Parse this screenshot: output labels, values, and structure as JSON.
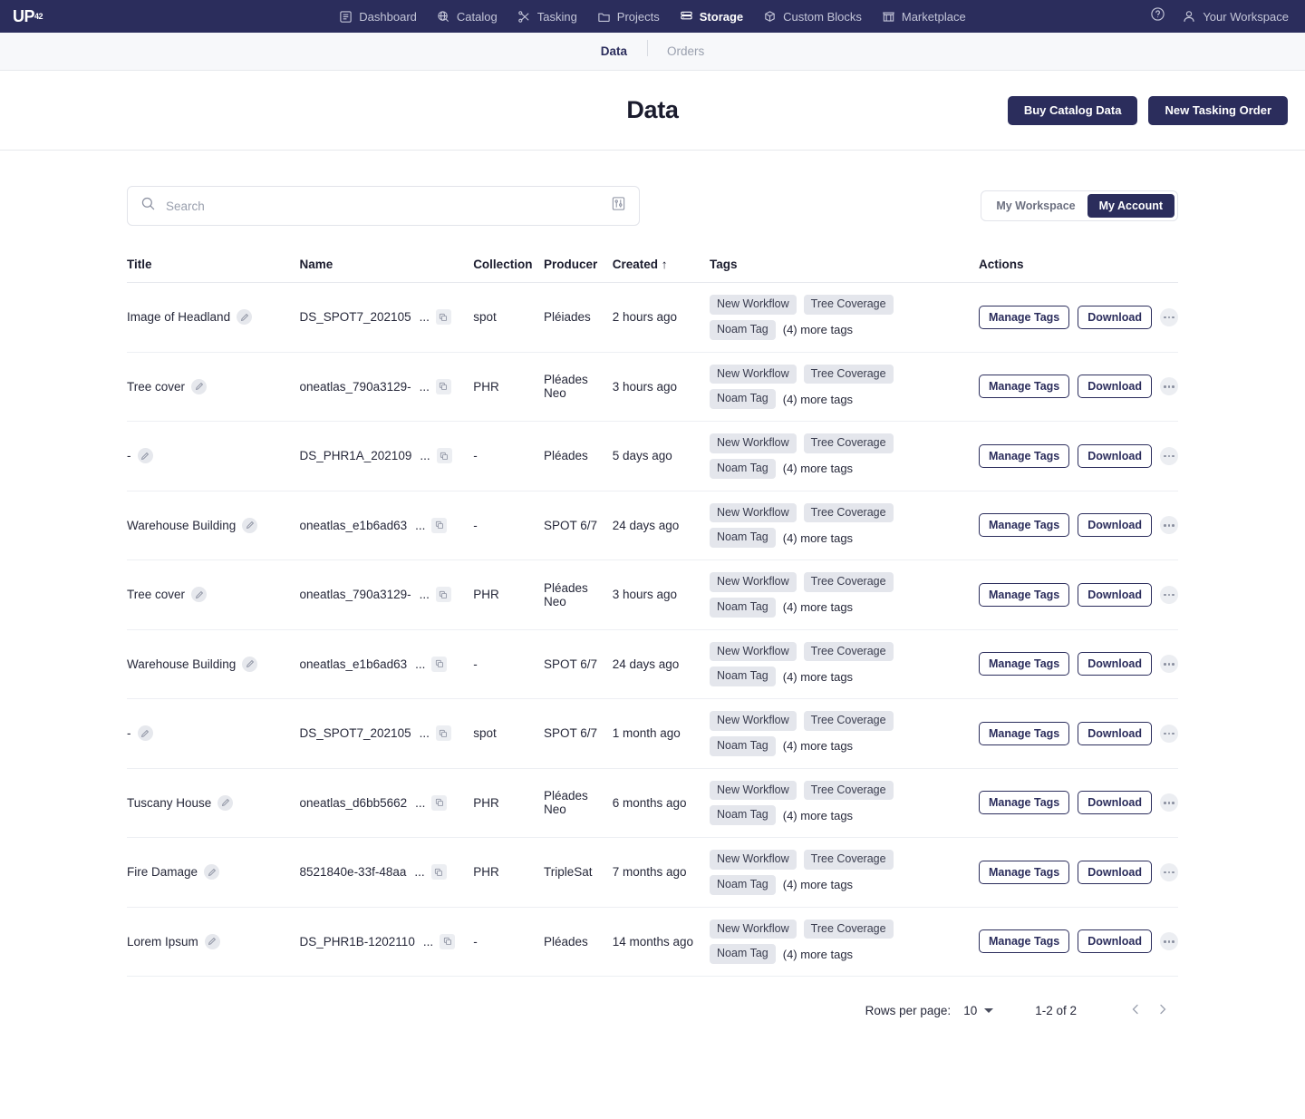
{
  "brand": {
    "name": "UP",
    "sup": "42",
    "accent": "#2b2d5c"
  },
  "topnav": {
    "items": [
      {
        "label": "Dashboard",
        "icon": "dashboard-icon",
        "active": false
      },
      {
        "label": "Catalog",
        "icon": "catalog-globe-icon",
        "active": false
      },
      {
        "label": "Tasking",
        "icon": "tasking-satellite-icon",
        "active": false
      },
      {
        "label": "Projects",
        "icon": "folder-icon",
        "active": false
      },
      {
        "label": "Storage",
        "icon": "storage-stack-icon",
        "active": true
      },
      {
        "label": "Custom Blocks",
        "icon": "cube-icon",
        "active": false
      },
      {
        "label": "Marketplace",
        "icon": "marketplace-store-icon",
        "active": false
      }
    ],
    "help_icon": "help-circle-icon",
    "account_icon": "user-icon",
    "account_label": "Your Workspace"
  },
  "subtabs": [
    {
      "label": "Data",
      "active": true
    },
    {
      "label": "Orders",
      "active": false
    }
  ],
  "header": {
    "title": "Data",
    "buy_catalog_label": "Buy Catalog Data",
    "new_tasking_label": "New Tasking Order"
  },
  "search": {
    "placeholder": "Search",
    "value": "",
    "icon": "search-icon",
    "filter_icon": "filter-sliders-icon"
  },
  "scope_toggle": {
    "options": [
      {
        "label": "My Workspace",
        "active": false
      },
      {
        "label": "My Account",
        "active": true
      }
    ]
  },
  "table": {
    "columns": [
      {
        "key": "title",
        "label": "Title"
      },
      {
        "key": "name",
        "label": "Name"
      },
      {
        "key": "collection",
        "label": "Collection"
      },
      {
        "key": "producer",
        "label": "Producer"
      },
      {
        "key": "created",
        "label": "Created ↑"
      },
      {
        "key": "tags",
        "label": "Tags"
      },
      {
        "key": "actions",
        "label": "Actions"
      }
    ],
    "row_actions": {
      "manage_tags_label": "Manage Tags",
      "download_label": "Download",
      "kebab_icon": "more-horizontal-icon",
      "edit_icon": "pencil-icon",
      "copy_icon": "copy-icon"
    },
    "rows": [
      {
        "title": "Image of Headland",
        "name": "DS_SPOT7_202105",
        "name_truncated": "...",
        "collection": "spot",
        "producer": "Pléiades",
        "created": "2 hours ago",
        "tags": [
          "New Workflow",
          "Tree Coverage",
          "Noam Tag"
        ],
        "more_tags": "(4) more tags"
      },
      {
        "title": "Tree cover",
        "name": "oneatlas_790a3129-",
        "name_truncated": "...",
        "collection": "PHR",
        "producer": "Pléades Neo",
        "created": "3 hours ago",
        "tags": [
          "New Workflow",
          "Tree Coverage",
          "Noam Tag"
        ],
        "more_tags": "(4) more tags"
      },
      {
        "title": "-",
        "name": "DS_PHR1A_202109",
        "name_truncated": "...",
        "collection": "-",
        "producer": "Pléades",
        "created": "5 days ago",
        "tags": [
          "New Workflow",
          "Tree Coverage",
          "Noam Tag"
        ],
        "more_tags": "(4) more tags"
      },
      {
        "title": "Warehouse Building",
        "name": "oneatlas_e1b6ad63",
        "name_truncated": "...",
        "collection": "-",
        "producer": "SPOT 6/7",
        "created": "24 days ago",
        "tags": [
          "New Workflow",
          "Tree Coverage",
          "Noam Tag"
        ],
        "more_tags": "(4) more tags"
      },
      {
        "title": "Tree cover",
        "name": "oneatlas_790a3129-",
        "name_truncated": "...",
        "collection": "PHR",
        "producer": "Pléades Neo",
        "created": "3 hours ago",
        "tags": [
          "New Workflow",
          "Tree Coverage",
          "Noam Tag"
        ],
        "more_tags": "(4) more tags"
      },
      {
        "title": "Warehouse Building",
        "name": "oneatlas_e1b6ad63",
        "name_truncated": "...",
        "collection": "-",
        "producer": "SPOT 6/7",
        "created": "24 days ago",
        "tags": [
          "New Workflow",
          "Tree Coverage",
          "Noam Tag"
        ],
        "more_tags": "(4) more tags"
      },
      {
        "title": "-",
        "name": "DS_SPOT7_202105",
        "name_truncated": "...",
        "collection": "spot",
        "producer": "SPOT 6/7",
        "created": "1 month ago",
        "tags": [
          "New Workflow",
          "Tree Coverage",
          "Noam Tag"
        ],
        "more_tags": "(4) more tags"
      },
      {
        "title": "Tuscany House",
        "name": "oneatlas_d6bb5662",
        "name_truncated": "...",
        "collection": "PHR",
        "producer": "Pléades Neo",
        "created": "6 months ago",
        "tags": [
          "New Workflow",
          "Tree Coverage",
          "Noam Tag"
        ],
        "more_tags": "(4) more tags"
      },
      {
        "title": "Fire Damage",
        "name": "8521840e-33f-48aa",
        "name_truncated": "...",
        "collection": "PHR",
        "producer": "TripleSat",
        "created": "7 months ago",
        "tags": [
          "New Workflow",
          "Tree Coverage",
          "Noam Tag"
        ],
        "more_tags": "(4) more tags"
      },
      {
        "title": "Lorem Ipsum",
        "name": "DS_PHR1B-1202110",
        "name_truncated": "...",
        "collection": "-",
        "producer": "Pléades",
        "created": "14 months ago",
        "tags": [
          "New Workflow",
          "Tree Coverage",
          "Noam Tag"
        ],
        "more_tags": "(4) more tags"
      }
    ]
  },
  "pagination": {
    "rows_per_page_label": "Rows per page:",
    "rows_per_page_value": "10",
    "range": "1-2 of 2",
    "prev_icon": "chevron-left-icon",
    "next_icon": "chevron-right-icon"
  }
}
